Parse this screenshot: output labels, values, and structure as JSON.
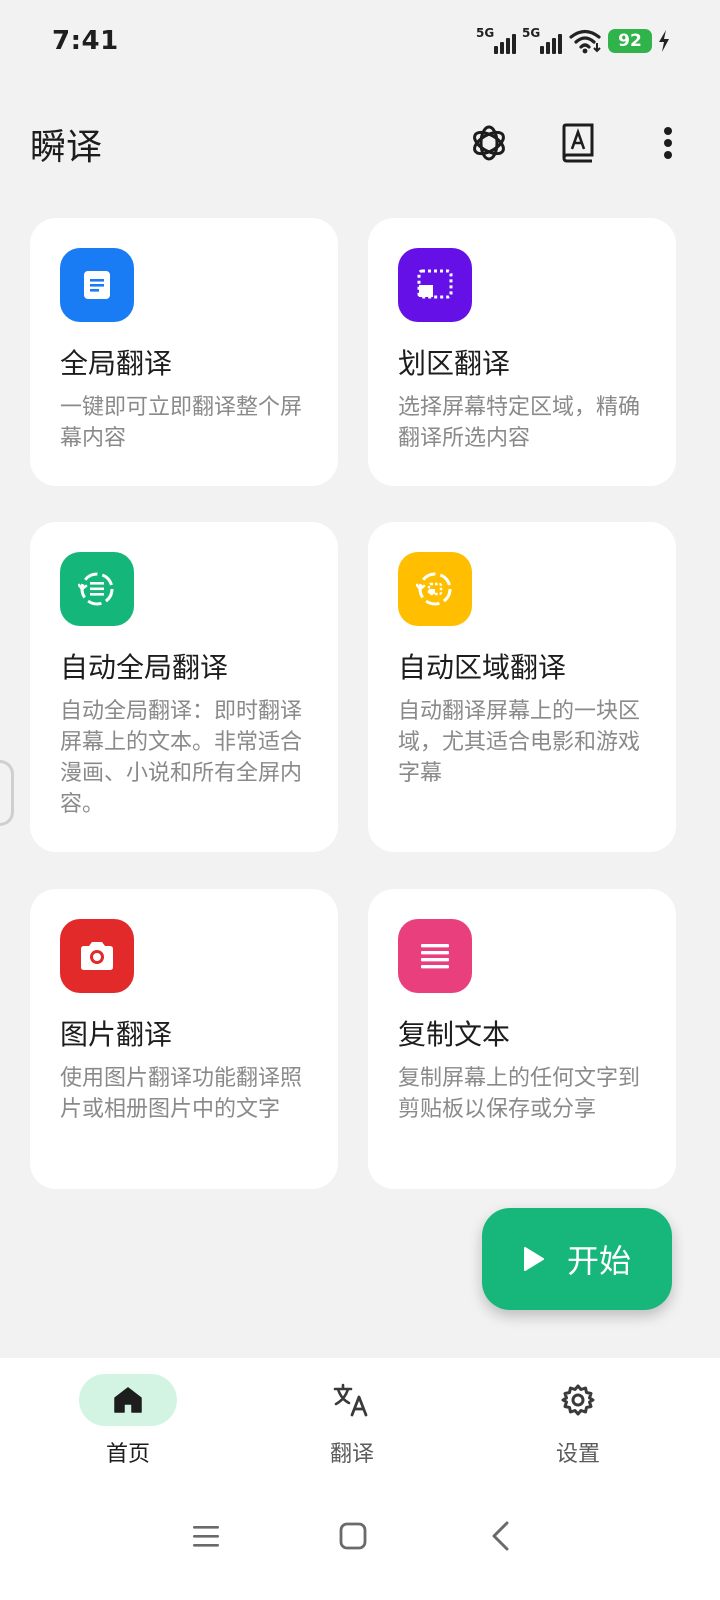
{
  "status_bar": {
    "time": "7:41",
    "sim1_network": "5G",
    "sim2_network": "5G",
    "battery_level": "92"
  },
  "app_bar": {
    "title": "瞬译",
    "actions": [
      "openai-icon",
      "dictionary-icon",
      "more-vert-icon"
    ]
  },
  "features": [
    {
      "title": "全局翻译",
      "description": "一键即可立即翻译整个屏幕内容",
      "icon": "document-icon",
      "color": "#1a7cf5"
    },
    {
      "title": "划区翻译",
      "description": "选择屏幕特定区域，精确翻译所选内容",
      "icon": "region-select-icon",
      "color": "#6410e6"
    },
    {
      "title": "自动全局翻译",
      "description": "自动全局翻译：即时翻译屏幕上的文本。非常适合漫画、小说和所有全屏内容。",
      "icon": "auto-global-icon",
      "color": "#15b67a"
    },
    {
      "title": "自动区域翻译",
      "description": "自动翻译屏幕上的一块区域，尤其适合电影和游戏字幕",
      "icon": "auto-region-icon",
      "color": "#ffbf00"
    },
    {
      "title": "图片翻译",
      "description": "使用图片翻译功能翻译照片或相册图片中的文字",
      "icon": "camera-icon",
      "color": "#e32a2a"
    },
    {
      "title": "复制文本",
      "description": "复制屏幕上的任何文字到剪贴板以保存或分享",
      "icon": "text-lines-icon",
      "color": "#e93f7c"
    }
  ],
  "fab": {
    "label": "开始",
    "color": "#17b77c"
  },
  "bottom_nav": {
    "items": [
      {
        "label": "首页",
        "icon": "home-icon",
        "active": true
      },
      {
        "label": "翻译",
        "icon": "translate-icon",
        "active": false
      },
      {
        "label": "设置",
        "icon": "gear-icon",
        "active": false
      }
    ]
  },
  "system_nav": [
    "menu-icon",
    "square-home-icon",
    "back-icon"
  ]
}
